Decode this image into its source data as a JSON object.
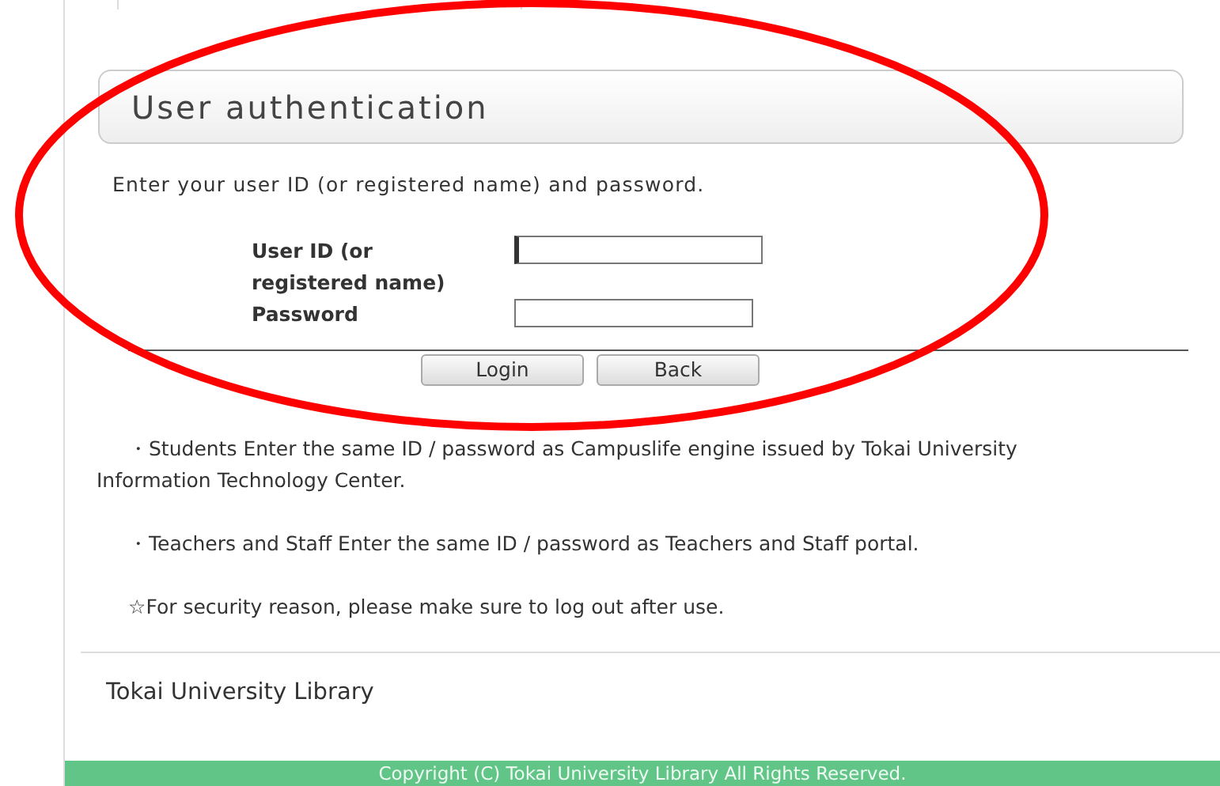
{
  "header": {
    "title": "User authentication"
  },
  "instruction": "Enter your user ID (or registered name) and password.",
  "fields": [
    {
      "label": "User ID (or registered name)",
      "focused": true
    },
    {
      "label": "Password",
      "focused": false
    }
  ],
  "buttons": [
    "Login",
    "Back"
  ],
  "notes": [
    "・Students Enter the same ID / password as Campuslife engine issued by Tokai University Information Technology Center.",
    "・Teachers and Staff Enter the same ID / password as Teachers and Staff portal.",
    "☆For security reason, please make sure to log out after use."
  ],
  "footer": {
    "name": "Tokai University Library",
    "copyright": "Copyright (C) Tokai University Library All Rights Reserved."
  }
}
